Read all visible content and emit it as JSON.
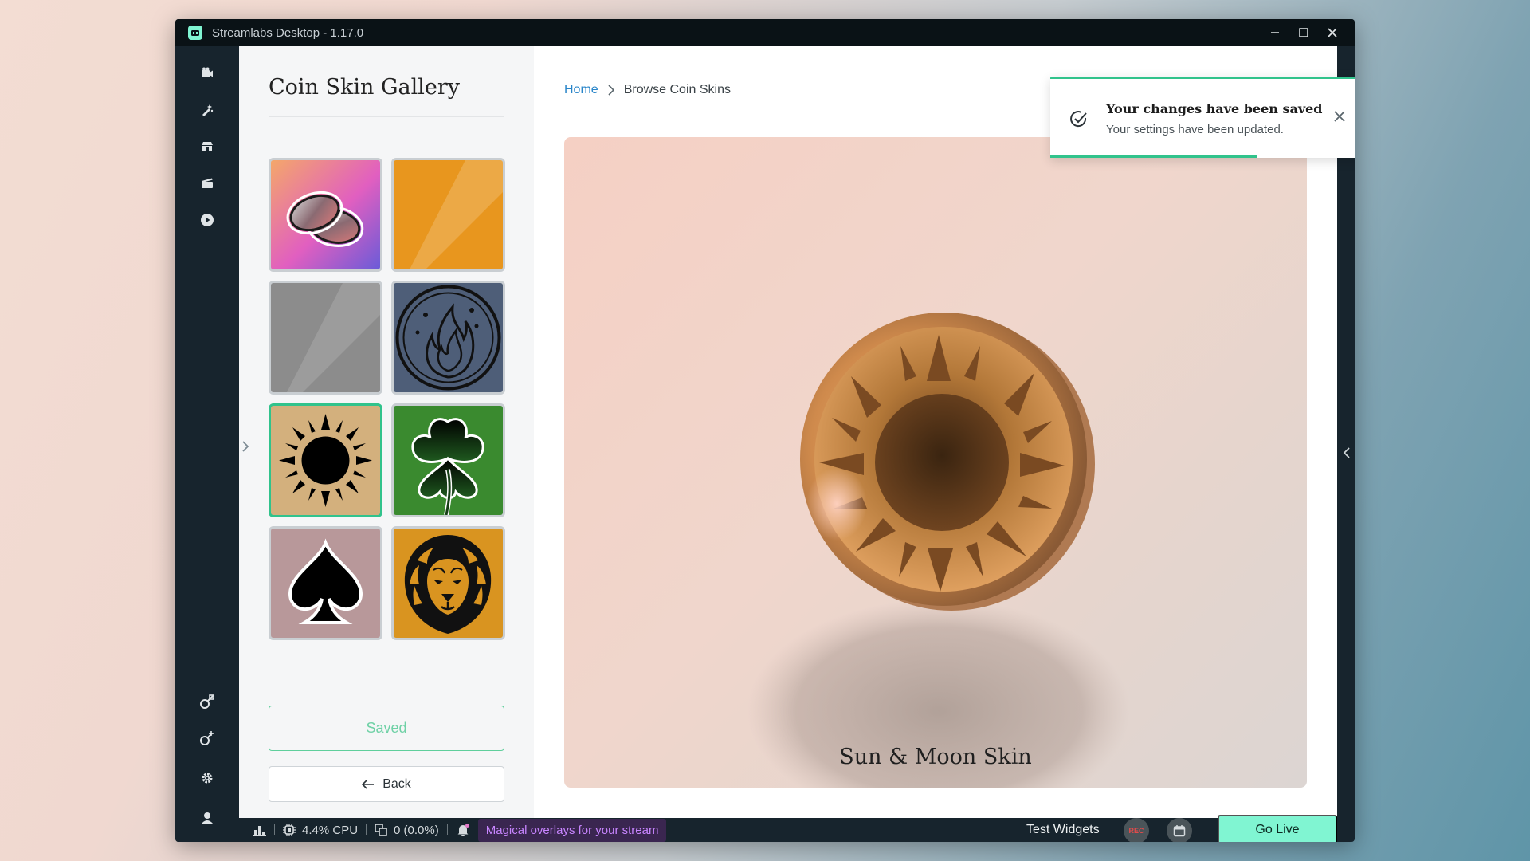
{
  "window": {
    "title": "Streamlabs Desktop - 1.17.0",
    "controls": [
      "minimize-icon",
      "maximize-icon",
      "close-icon"
    ]
  },
  "nav": {
    "top_items": [
      "camera-icon",
      "themes-icon",
      "store-icon",
      "studio-icon",
      "play-icon"
    ],
    "bottom_items": [
      "link-icon",
      "link-plus-icon",
      "gear-icon",
      "user-icon"
    ]
  },
  "gallery": {
    "title": "Coin Skin Gallery",
    "tiles": [
      {
        "name": "coins-gradient"
      },
      {
        "name": "orange-gloss"
      },
      {
        "name": "silver-gloss"
      },
      {
        "name": "fire-emblem"
      },
      {
        "name": "sun",
        "selected": true
      },
      {
        "name": "clover"
      },
      {
        "name": "spade"
      },
      {
        "name": "lion"
      }
    ],
    "saved_label": "Saved",
    "back_label": "Back"
  },
  "breadcrumb": {
    "home": "Home",
    "current": "Browse Coin Skins"
  },
  "preview": {
    "skin_name": "Sun & Moon Skin"
  },
  "toast": {
    "title": "Your changes have been saved",
    "message": "Your settings have been updated.",
    "progress": 0.65,
    "accent": "#31c38c"
  },
  "statusbar": {
    "cpu": "4.4% CPU",
    "dropped": "0 (0.0%)",
    "promo": "Magical overlays for your stream",
    "test_widgets": "Test Widgets",
    "rec": "REC",
    "go_live": "Go Live"
  },
  "colors": {
    "accent": "#80f5d2",
    "selected_border": "#31c38c",
    "link": "#2985c9",
    "promo_text": "#c885ff"
  }
}
